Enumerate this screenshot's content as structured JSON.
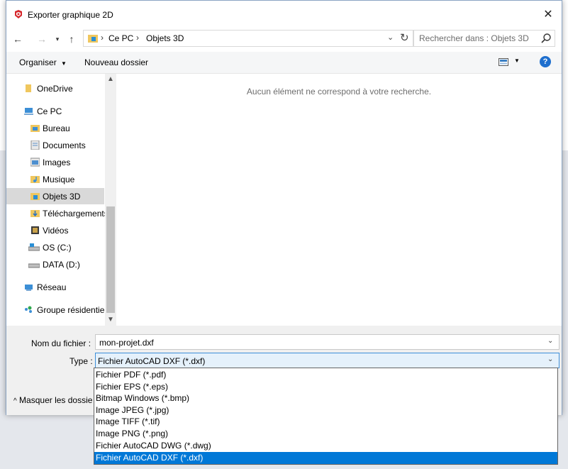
{
  "window": {
    "title": "Exporter graphique 2D"
  },
  "address": {
    "crumbs": [
      "Ce PC",
      "Objets 3D"
    ],
    "search_placeholder": "Rechercher dans : Objets 3D"
  },
  "toolbar": {
    "organize_label": "Organiser",
    "new_folder_label": "Nouveau dossier"
  },
  "nav": {
    "items": [
      {
        "label": "OneDrive",
        "icon": "onedrive-icon"
      },
      {
        "label": "Ce PC",
        "icon": "computer-icon"
      },
      {
        "label": "Bureau",
        "icon": "desktop-folder-icon"
      },
      {
        "label": "Documents",
        "icon": "documents-folder-icon"
      },
      {
        "label": "Images",
        "icon": "pictures-folder-icon"
      },
      {
        "label": "Musique",
        "icon": "music-folder-icon"
      },
      {
        "label": "Objets 3D",
        "icon": "3d-objects-folder-icon",
        "selected": true
      },
      {
        "label": "Téléchargements",
        "icon": "downloads-folder-icon"
      },
      {
        "label": "Vidéos",
        "icon": "videos-folder-icon"
      },
      {
        "label": "OS (C:)",
        "icon": "drive-icon"
      },
      {
        "label": "DATA (D:)",
        "icon": "drive-icon"
      },
      {
        "label": "Réseau",
        "icon": "network-icon"
      },
      {
        "label": "Groupe résidentiel",
        "icon": "homegroup-icon"
      }
    ]
  },
  "content": {
    "empty_message": "Aucun élément ne correspond à votre recherche."
  },
  "form": {
    "filename_label": "Nom du fichier :",
    "filename_value": "mon-projet.dxf",
    "type_label": "Type :",
    "type_value": "Fichier AutoCAD DXF (*.dxf)",
    "hide_folders_label": "Masquer les dossie"
  },
  "type_options": [
    "Fichier PDF (*.pdf)",
    "Fichier EPS (*.eps)",
    "Bitmap Windows (*.bmp)",
    "Image JPEG (*.jpg)",
    "Image TIFF (*.tif)",
    "Image PNG (*.png)",
    "Fichier AutoCAD DWG (*.dwg)",
    "Fichier AutoCAD DXF (*.dxf)"
  ],
  "selected_type_index": 7,
  "colors": {
    "accent": "#0078d7",
    "help": "#1e6fce",
    "selected_nav": "#d9d9d9"
  }
}
